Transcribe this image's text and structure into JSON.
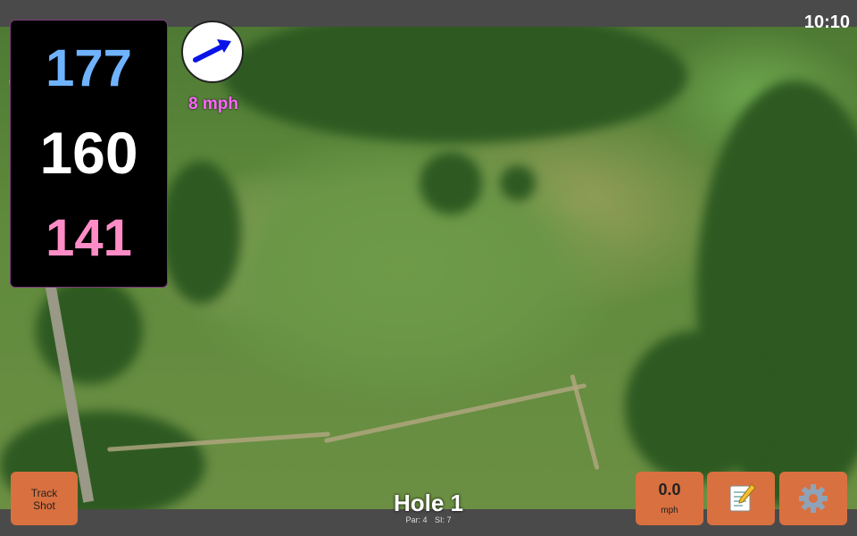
{
  "status": {
    "time": "10:10"
  },
  "yardages": {
    "back": "177",
    "middle": "160",
    "front": "141"
  },
  "wind": {
    "speed": "8 mph",
    "direction_icon": "arrow-icon"
  },
  "buttons": {
    "track_shot": "Track\nShot",
    "speed_value": "0.0",
    "speed_unit": "mph",
    "notes_icon": "notepad-icon",
    "settings_icon": "gear-icon"
  },
  "hole": {
    "title": "Hole 1",
    "par": "Par: 4",
    "si": "SI: 7"
  },
  "colors": {
    "back": "#6fb3ff",
    "middle": "#ffffff",
    "front": "#ff8cc6",
    "wind_text": "#ff66ff",
    "button": "#d9703f"
  }
}
